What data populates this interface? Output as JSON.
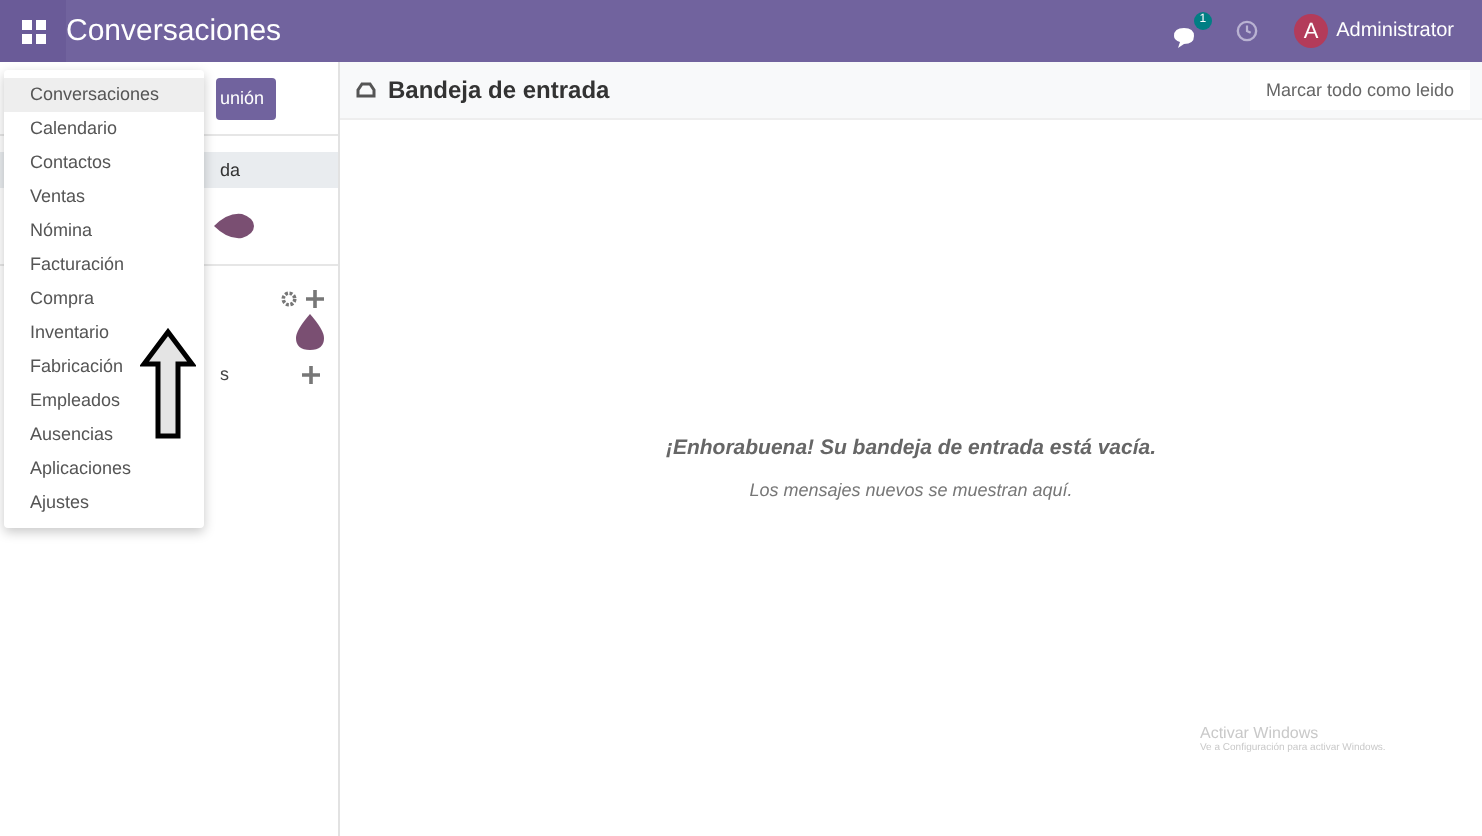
{
  "topbar": {
    "title": "Conversaciones",
    "chat_badge": "1",
    "user_initial": "A",
    "user_name": "Administrator"
  },
  "app_menu": {
    "items": [
      {
        "label": "Conversaciones",
        "selected": true
      },
      {
        "label": "Calendario",
        "selected": false
      },
      {
        "label": "Contactos",
        "selected": false
      },
      {
        "label": "Ventas",
        "selected": false
      },
      {
        "label": "Nómina",
        "selected": false
      },
      {
        "label": "Facturación",
        "selected": false
      },
      {
        "label": "Compra",
        "selected": false
      },
      {
        "label": "Inventario",
        "selected": false
      },
      {
        "label": "Fabricación",
        "selected": false
      },
      {
        "label": "Empleados",
        "selected": false
      },
      {
        "label": "Ausencias",
        "selected": false
      },
      {
        "label": "Aplicaciones",
        "selected": false
      },
      {
        "label": "Ajustes",
        "selected": false
      }
    ]
  },
  "sidebar": {
    "button": "unión",
    "items": [
      {
        "label": "da",
        "selected": true
      }
    ],
    "section_label": "s"
  },
  "main": {
    "title": "Bandeja de entrada",
    "mark_all": "Marcar todo como leido",
    "empty_title": "¡Enhorabuena! Su bandeja de entrada está vacía.",
    "empty_text": "Los mensajes nuevos se muestran aquí."
  },
  "system_notice": {
    "title": "Activar Windows",
    "text": "Ve a Configuración para activar Windows."
  }
}
